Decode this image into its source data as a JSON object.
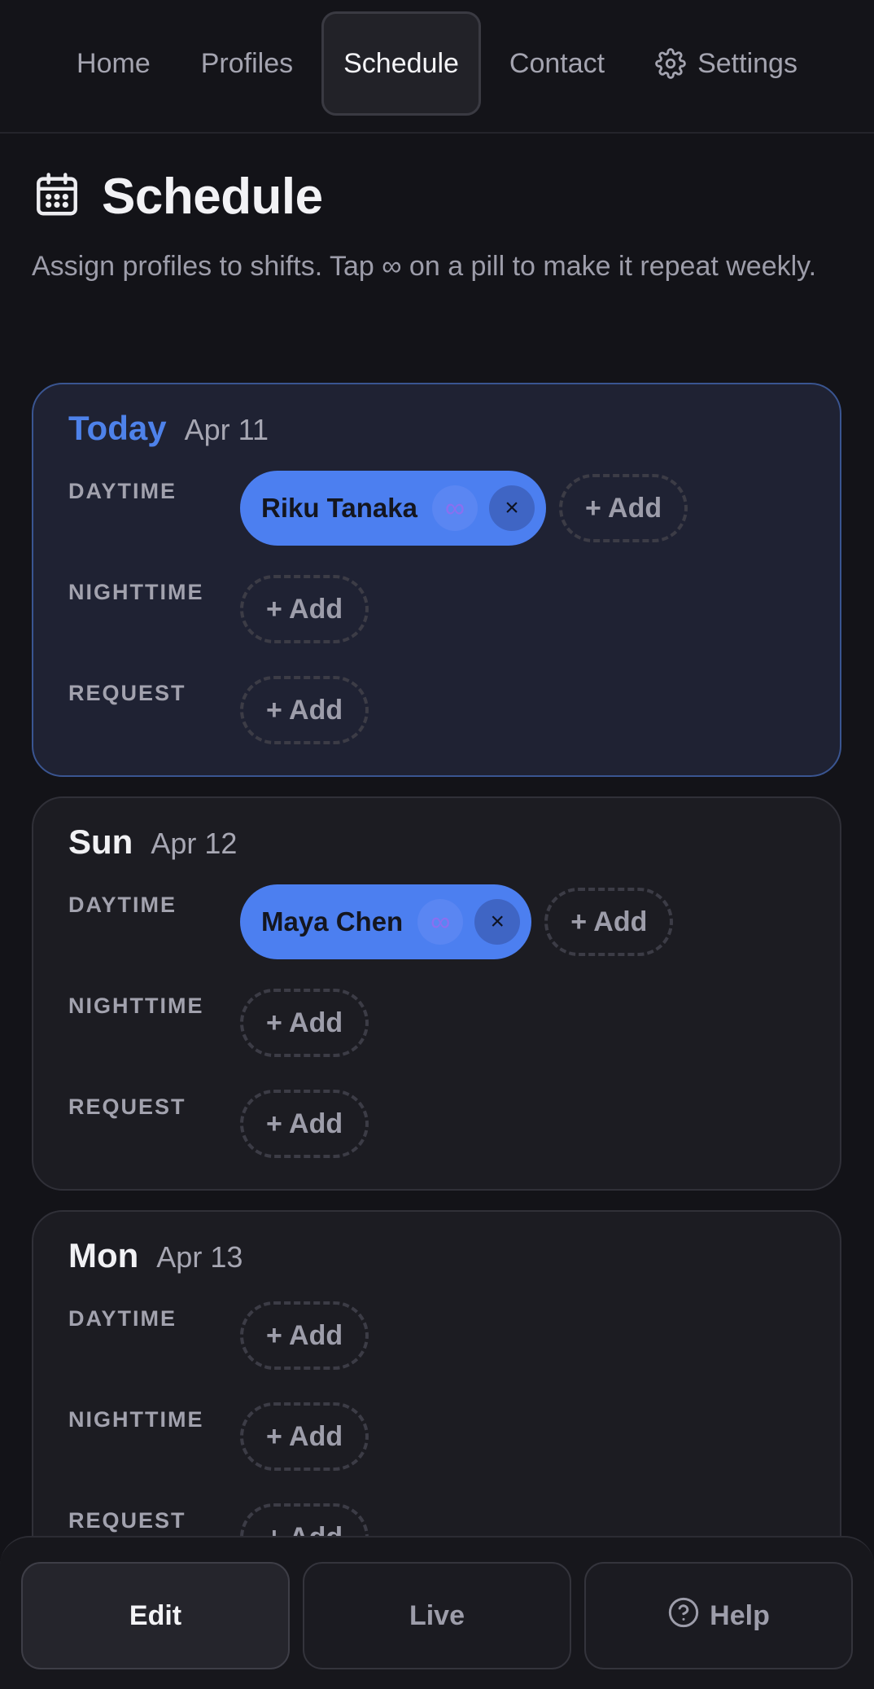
{
  "nav": {
    "items": [
      {
        "label": "Home"
      },
      {
        "label": "Profiles"
      },
      {
        "label": "Schedule"
      },
      {
        "label": "Contact"
      },
      {
        "label": "Settings",
        "icon": "gear-icon"
      }
    ],
    "active": "Schedule"
  },
  "page": {
    "icon": "calendar-icon",
    "title": "Schedule",
    "subtitle": "Assign profiles to shifts. Tap ∞ on a pill to make it repeat weekly."
  },
  "days": [
    {
      "name": "Today",
      "date": "Apr 11",
      "highlight": true,
      "shifts": [
        {
          "label": "DAYTIME",
          "assignees": [
            "Riku Tanaka"
          ],
          "add_label": "+ Add"
        },
        {
          "label": "NIGHTTIME",
          "assignees": [],
          "add_label": "+ Add"
        },
        {
          "label": "REQUEST",
          "assignees": [],
          "add_label": "+ Add"
        }
      ]
    },
    {
      "name": "Sun",
      "date": "Apr 12",
      "highlight": false,
      "shifts": [
        {
          "label": "DAYTIME",
          "assignees": [
            "Maya Chen"
          ],
          "add_label": "+ Add"
        },
        {
          "label": "NIGHTTIME",
          "assignees": [],
          "add_label": "+ Add"
        },
        {
          "label": "REQUEST",
          "assignees": [],
          "add_label": "+ Add"
        }
      ]
    },
    {
      "name": "Mon",
      "date": "Apr 13",
      "highlight": false,
      "shifts": [
        {
          "label": "DAYTIME",
          "assignees": [],
          "add_label": "+ Add"
        },
        {
          "label": "NIGHTTIME",
          "assignees": [],
          "add_label": "+ Add"
        },
        {
          "label": "REQUEST",
          "assignees": [],
          "add_label": "+ Add"
        }
      ]
    }
  ],
  "pill_icons": {
    "repeat": "∞",
    "remove": "×"
  },
  "bottom_tabs": [
    {
      "label": "Edit",
      "active": true
    },
    {
      "label": "Live",
      "active": false
    },
    {
      "label": "Help",
      "active": false,
      "icon": "help-circle-icon"
    }
  ],
  "colors": {
    "accent": "#4c7ff0",
    "today": "#4e82ea",
    "background": "#131318"
  }
}
